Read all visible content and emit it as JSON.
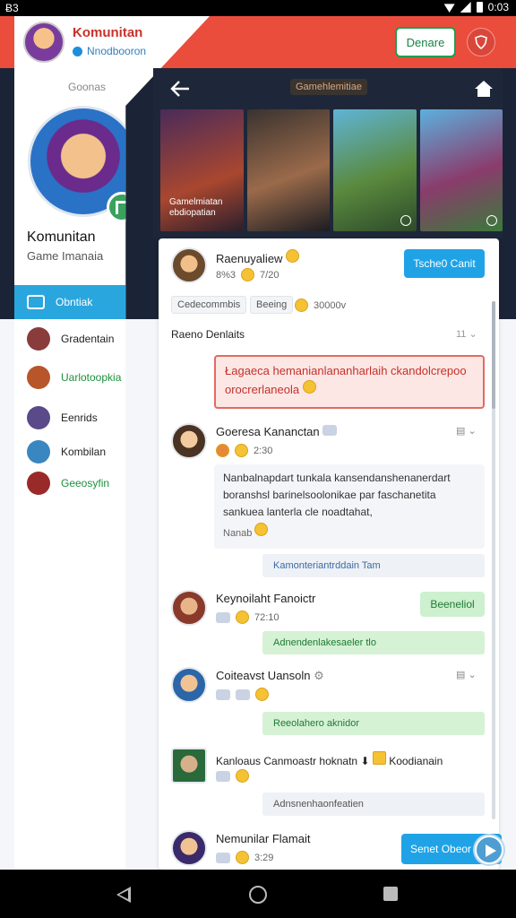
{
  "statusbar": {
    "left": "Ƀ3",
    "time": "0:03"
  },
  "header": {
    "button_label": "Denare"
  },
  "sidebar": {
    "title": "Komunitan",
    "subtitle": "Nnodbooron",
    "section_label": "Goonas",
    "profile_name": "Komunitan",
    "profile_role": "Game Imanaia",
    "menu": [
      {
        "label": "Obntiak",
        "icon": "window-icon"
      },
      {
        "label": "Gradentain",
        "icon": "avatar"
      },
      {
        "label": "Uarlotoopkia",
        "icon": "avatar"
      },
      {
        "label": "Eenrids",
        "icon": "avatar"
      },
      {
        "label": "Kombilan",
        "icon": "avatar"
      },
      {
        "label": "Geeosyfin",
        "icon": "avatar"
      }
    ]
  },
  "panel": {
    "title": "Gamehlemitiae",
    "thumb_caption": "Gamelmiatan ebdiopatian"
  },
  "posts": {
    "p1": {
      "name": "Raenuyaliew",
      "meta": [
        "8%3",
        "7/20"
      ],
      "button": "Tsche0 Canit",
      "tags": [
        "Cedecommbis",
        "Beeing",
        "30000v"
      ]
    },
    "section": {
      "title": "Raeno Denlaits",
      "count": "11"
    },
    "alert": "Łagaeca hemanianlananharlaih ckandolcrepoo orocrerlaneola",
    "p2": {
      "name": "Goeresa Kananctan",
      "meta": "2:30",
      "body": "Nanbalnapdart tunkala kansendanshenanerdart boranshsl barinelsoolonikae par faschanetita sankuea lanterla cle noadtahat,",
      "body_footer": "Nanab",
      "reply": "Kamonteriantrddain Tam"
    },
    "p3": {
      "name": "Keynoilaht Fanoictr",
      "meta": "72:10",
      "button": "Beeneliol",
      "reply": "Adnendenlakesaeler tlo"
    },
    "p4": {
      "name": "Coiteavst Uansoln",
      "reply": "Reeolahero aknidor"
    },
    "p5": {
      "name": "Kanloaus Canmoastr  hoknatn",
      "extra": "Koodianain",
      "reply": "Adnsnenhaonfeatien"
    },
    "p6": {
      "name": "Nemunilar Flamait",
      "meta": "3:29"
    }
  },
  "composer": {
    "send_label": "Senet Obeor"
  }
}
